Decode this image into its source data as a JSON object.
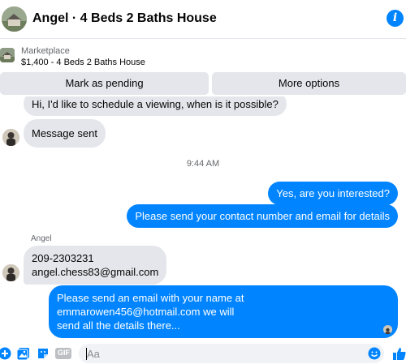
{
  "header": {
    "title": "Angel · 4 Beds 2 Baths House",
    "info_icon": "i"
  },
  "marketplace": {
    "label": "Marketplace",
    "listing": "$1,400 - 4 Beds 2 Baths House"
  },
  "actions": {
    "pending_label": "Mark as pending",
    "more_label": "More options"
  },
  "thread": {
    "partial_message": "Hi, I'd like to schedule a viewing, when is it possible?",
    "message_sent": "Message sent",
    "timestamp": "9:44 AM",
    "out_1": "Yes, are you interested?",
    "out_2": "Please send your contact number and email for details",
    "sender_name": "Angel",
    "in_phone": "209-2303231",
    "in_email": "angel.chess83@gmail.com",
    "out_3_line1": "Please send an email with your name at emmarowen456@hotmail.com we will",
    "out_3_line2": "send all the details there..."
  },
  "composer": {
    "placeholder": "Aa",
    "gif_label": "GIF"
  },
  "colors": {
    "accent": "#0084ff",
    "incoming_bubble": "#e4e6eb",
    "button_bg": "#e4e6eb"
  }
}
